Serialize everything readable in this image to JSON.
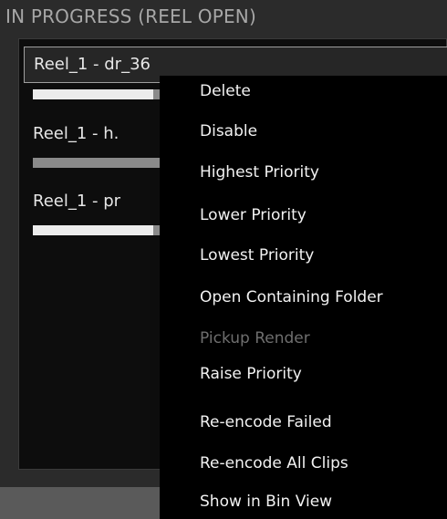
{
  "panel": {
    "title": "IN PROGRESS (REEL OPEN)"
  },
  "jobs": [
    {
      "label": "Reel_1  -  dr_36",
      "progress": 0.3,
      "selected": true
    },
    {
      "label": "Reel_1  -  h.",
      "progress": 0.0,
      "selected": false
    },
    {
      "label": "Reel_1  -  pr",
      "progress": 0.3,
      "selected": false
    }
  ],
  "context_menu": {
    "items": [
      {
        "label": "Delete",
        "enabled": true
      },
      {
        "label": "Disable",
        "enabled": true
      },
      {
        "label": "Highest Priority",
        "enabled": true
      },
      {
        "label": "Lower Priority",
        "enabled": true
      },
      {
        "label": "Lowest Priority",
        "enabled": true
      },
      {
        "label": "Open Containing Folder",
        "enabled": true
      },
      {
        "label": "Pickup Render",
        "enabled": false
      },
      {
        "label": "Raise Priority",
        "enabled": true
      },
      {
        "label": "Re-encode Failed",
        "enabled": true
      },
      {
        "label": "Re-encode All Clips",
        "enabled": true
      },
      {
        "label": "Show in Bin View",
        "enabled": true
      }
    ]
  },
  "colors": {
    "panel_bg": "#2b2b2b",
    "list_bg": "#0d0d0d",
    "menu_bg": "#000000",
    "menu_text": "#f2f2f2",
    "menu_text_disabled": "#6e6e6e",
    "progress_track": "#8a8a8a",
    "progress_fill": "#ececec"
  }
}
